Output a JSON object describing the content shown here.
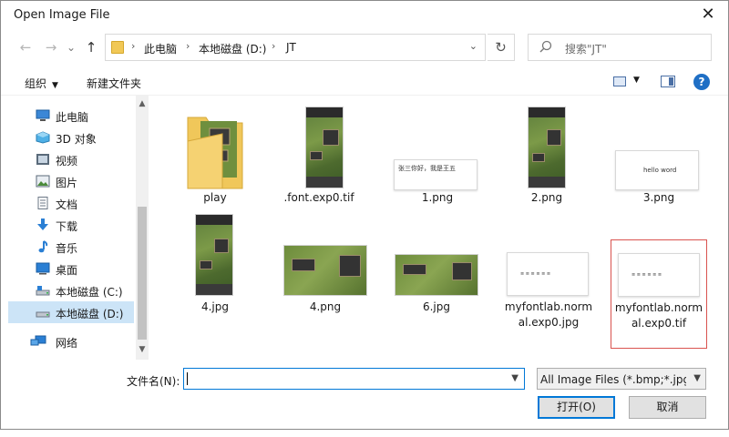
{
  "window": {
    "title": "Open Image File",
    "close_glyph": "✕"
  },
  "nav": {
    "back_glyph": "←",
    "forward_glyph": "→",
    "recent_glyph": "⌄",
    "up_glyph": "↑",
    "refresh_glyph": "↻"
  },
  "address": {
    "folder_icon": "folder-icon",
    "crumbs": [
      "此电脑",
      "本地磁盘 (D:)",
      "JT"
    ],
    "separator": "›",
    "dropdown_glyph": "⌄"
  },
  "search": {
    "placeholder": "搜索\"JT\"",
    "icon": "search-icon"
  },
  "toolbar": {
    "organize_label": "组织",
    "new_folder_label": "新建文件夹",
    "help_label": "?"
  },
  "sidebar": {
    "items": [
      {
        "label": "此电脑",
        "icon": "computer-icon",
        "selected": false
      },
      {
        "label": "3D 对象",
        "icon": "3d-objects-icon",
        "selected": false
      },
      {
        "label": "视频",
        "icon": "video-icon",
        "selected": false
      },
      {
        "label": "图片",
        "icon": "pictures-icon",
        "selected": false
      },
      {
        "label": "文档",
        "icon": "documents-icon",
        "selected": false
      },
      {
        "label": "下载",
        "icon": "download-icon",
        "selected": false
      },
      {
        "label": "音乐",
        "icon": "music-icon",
        "selected": false
      },
      {
        "label": "桌面",
        "icon": "desktop-icon",
        "selected": false
      },
      {
        "label": "本地磁盘 (C:)",
        "icon": "drive-icon",
        "selected": false
      },
      {
        "label": "本地磁盘 (D:)",
        "icon": "drive-icon",
        "selected": true
      },
      {
        "label": "网络",
        "icon": "network-icon",
        "selected": false
      }
    ]
  },
  "files": [
    {
      "name_line1": "play",
      "name_line2": "",
      "kind": "folder"
    },
    {
      "name_line1": ".font.exp0.tif",
      "name_line2": "",
      "kind": "game-portrait"
    },
    {
      "name_line1": "1.png",
      "name_line2": "",
      "kind": "text-card",
      "card_text": "张三你好，我是王五"
    },
    {
      "name_line1": "2.png",
      "name_line2": "",
      "kind": "game-portrait"
    },
    {
      "name_line1": "3.png",
      "name_line2": "",
      "kind": "text-card",
      "card_text": "hello word"
    },
    {
      "name_line1": "4.jpg",
      "name_line2": "",
      "kind": "game-portrait"
    },
    {
      "name_line1": "4.png",
      "name_line2": "",
      "kind": "game-land"
    },
    {
      "name_line1": "6.jpg",
      "name_line2": "",
      "kind": "game-land"
    },
    {
      "name_line1": "myfontlab.norm",
      "name_line2": "al.exp0.jpg",
      "kind": "text-card-small"
    },
    {
      "name_line1": "myfontlab.norm",
      "name_line2": "al.exp0.tif",
      "kind": "text-card-small",
      "highlighted": true
    }
  ],
  "bottom": {
    "filename_label": "文件名(N):",
    "filename_value": "",
    "filter_value": "All Image Files (*.bmp;*.jpg;*",
    "open_label": "打开(O)",
    "cancel_label": "取消"
  },
  "colors": {
    "accent": "#0078d7",
    "selected_nav": "#cce4f7",
    "highlight_border": "#d9534f"
  }
}
